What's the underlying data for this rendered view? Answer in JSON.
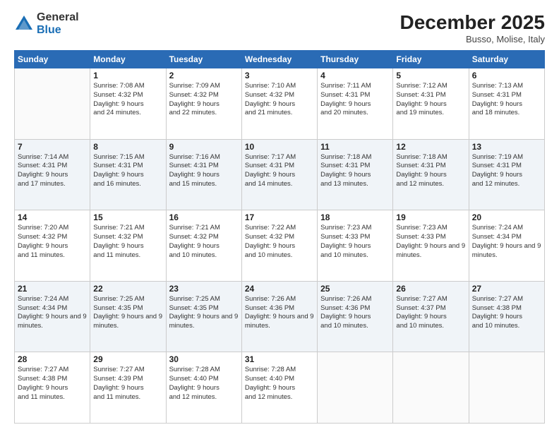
{
  "header": {
    "logo": {
      "general": "General",
      "blue": "Blue"
    },
    "title": "December 2025",
    "location": "Busso, Molise, Italy"
  },
  "days_of_week": [
    "Sunday",
    "Monday",
    "Tuesday",
    "Wednesday",
    "Thursday",
    "Friday",
    "Saturday"
  ],
  "weeks": [
    [
      {
        "day": null
      },
      {
        "day": 1,
        "sunrise": "7:08 AM",
        "sunset": "4:32 PM",
        "daylight": "9 hours and 24 minutes."
      },
      {
        "day": 2,
        "sunrise": "7:09 AM",
        "sunset": "4:32 PM",
        "daylight": "9 hours and 22 minutes."
      },
      {
        "day": 3,
        "sunrise": "7:10 AM",
        "sunset": "4:32 PM",
        "daylight": "9 hours and 21 minutes."
      },
      {
        "day": 4,
        "sunrise": "7:11 AM",
        "sunset": "4:31 PM",
        "daylight": "9 hours and 20 minutes."
      },
      {
        "day": 5,
        "sunrise": "7:12 AM",
        "sunset": "4:31 PM",
        "daylight": "9 hours and 19 minutes."
      },
      {
        "day": 6,
        "sunrise": "7:13 AM",
        "sunset": "4:31 PM",
        "daylight": "9 hours and 18 minutes."
      }
    ],
    [
      {
        "day": 7,
        "sunrise": "7:14 AM",
        "sunset": "4:31 PM",
        "daylight": "9 hours and 17 minutes."
      },
      {
        "day": 8,
        "sunrise": "7:15 AM",
        "sunset": "4:31 PM",
        "daylight": "9 hours and 16 minutes."
      },
      {
        "day": 9,
        "sunrise": "7:16 AM",
        "sunset": "4:31 PM",
        "daylight": "9 hours and 15 minutes."
      },
      {
        "day": 10,
        "sunrise": "7:17 AM",
        "sunset": "4:31 PM",
        "daylight": "9 hours and 14 minutes."
      },
      {
        "day": 11,
        "sunrise": "7:18 AM",
        "sunset": "4:31 PM",
        "daylight": "9 hours and 13 minutes."
      },
      {
        "day": 12,
        "sunrise": "7:18 AM",
        "sunset": "4:31 PM",
        "daylight": "9 hours and 12 minutes."
      },
      {
        "day": 13,
        "sunrise": "7:19 AM",
        "sunset": "4:31 PM",
        "daylight": "9 hours and 12 minutes."
      }
    ],
    [
      {
        "day": 14,
        "sunrise": "7:20 AM",
        "sunset": "4:32 PM",
        "daylight": "9 hours and 11 minutes."
      },
      {
        "day": 15,
        "sunrise": "7:21 AM",
        "sunset": "4:32 PM",
        "daylight": "9 hours and 11 minutes."
      },
      {
        "day": 16,
        "sunrise": "7:21 AM",
        "sunset": "4:32 PM",
        "daylight": "9 hours and 10 minutes."
      },
      {
        "day": 17,
        "sunrise": "7:22 AM",
        "sunset": "4:32 PM",
        "daylight": "9 hours and 10 minutes."
      },
      {
        "day": 18,
        "sunrise": "7:23 AM",
        "sunset": "4:33 PM",
        "daylight": "9 hours and 10 minutes."
      },
      {
        "day": 19,
        "sunrise": "7:23 AM",
        "sunset": "4:33 PM",
        "daylight": "9 hours and 9 minutes."
      },
      {
        "day": 20,
        "sunrise": "7:24 AM",
        "sunset": "4:34 PM",
        "daylight": "9 hours and 9 minutes."
      }
    ],
    [
      {
        "day": 21,
        "sunrise": "7:24 AM",
        "sunset": "4:34 PM",
        "daylight": "9 hours and 9 minutes."
      },
      {
        "day": 22,
        "sunrise": "7:25 AM",
        "sunset": "4:35 PM",
        "daylight": "9 hours and 9 minutes."
      },
      {
        "day": 23,
        "sunrise": "7:25 AM",
        "sunset": "4:35 PM",
        "daylight": "9 hours and 9 minutes."
      },
      {
        "day": 24,
        "sunrise": "7:26 AM",
        "sunset": "4:36 PM",
        "daylight": "9 hours and 9 minutes."
      },
      {
        "day": 25,
        "sunrise": "7:26 AM",
        "sunset": "4:36 PM",
        "daylight": "9 hours and 10 minutes."
      },
      {
        "day": 26,
        "sunrise": "7:27 AM",
        "sunset": "4:37 PM",
        "daylight": "9 hours and 10 minutes."
      },
      {
        "day": 27,
        "sunrise": "7:27 AM",
        "sunset": "4:38 PM",
        "daylight": "9 hours and 10 minutes."
      }
    ],
    [
      {
        "day": 28,
        "sunrise": "7:27 AM",
        "sunset": "4:38 PM",
        "daylight": "9 hours and 11 minutes."
      },
      {
        "day": 29,
        "sunrise": "7:27 AM",
        "sunset": "4:39 PM",
        "daylight": "9 hours and 11 minutes."
      },
      {
        "day": 30,
        "sunrise": "7:28 AM",
        "sunset": "4:40 PM",
        "daylight": "9 hours and 12 minutes."
      },
      {
        "day": 31,
        "sunrise": "7:28 AM",
        "sunset": "4:40 PM",
        "daylight": "9 hours and 12 minutes."
      },
      {
        "day": null
      },
      {
        "day": null
      },
      {
        "day": null
      }
    ]
  ],
  "labels": {
    "sunrise_prefix": "Sunrise:",
    "sunset_prefix": "Sunset:",
    "daylight_prefix": "Daylight:"
  }
}
